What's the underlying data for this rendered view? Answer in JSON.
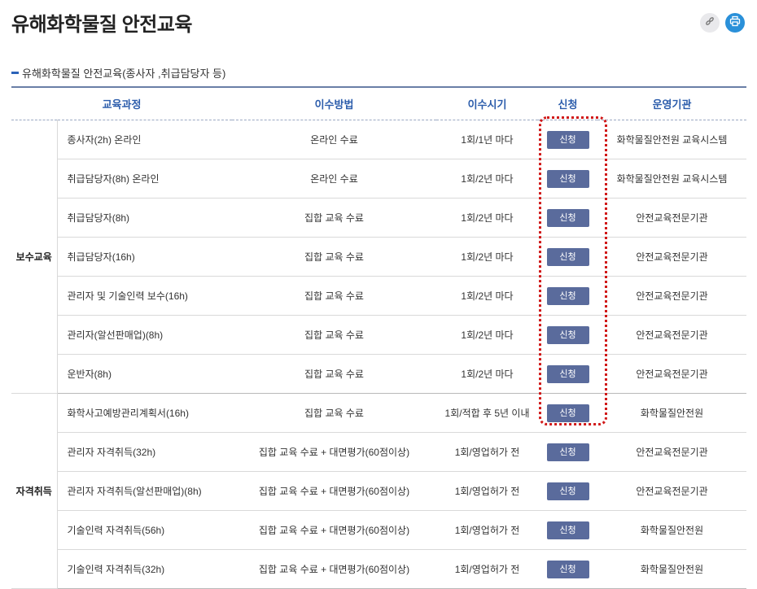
{
  "page": {
    "title": "유해화학물질 안전교육",
    "section_title": "유해화학물질 안전교육(종사자 ,취급담당자 등)"
  },
  "toolbar": {
    "link_icon": "link-icon",
    "print_icon": "print-icon",
    "print_color": "#2a90d9"
  },
  "table": {
    "headers": [
      "교육과정",
      "이수방법",
      "이수시기",
      "신청",
      "운영기관"
    ],
    "groups": [
      {
        "label": "보수교육",
        "rows": [
          {
            "course": "종사자(2h) 온라인",
            "method": "온라인 수료",
            "period": "1회/1년 마다",
            "apply": "신청",
            "org": "화학물질안전원 교육시스템"
          },
          {
            "course": "취급담당자(8h) 온라인",
            "method": "온라인 수료",
            "period": "1회/2년 마다",
            "apply": "신청",
            "org": "화학물질안전원 교육시스템"
          },
          {
            "course": "취급담당자(8h)",
            "method": "집합 교육 수료",
            "period": "1회/2년 마다",
            "apply": "신청",
            "org": "안전교육전문기관"
          },
          {
            "course": "취급담당자(16h)",
            "method": "집합 교육 수료",
            "period": "1회/2년 마다",
            "apply": "신청",
            "org": "안전교육전문기관"
          },
          {
            "course": "관리자 및 기술인력 보수(16h)",
            "method": "집합 교육 수료",
            "period": "1회/2년 마다",
            "apply": "신청",
            "org": "안전교육전문기관"
          },
          {
            "course": "관리자(알선판매업)(8h)",
            "method": "집합 교육 수료",
            "period": "1회/2년 마다",
            "apply": "신청",
            "org": "안전교육전문기관"
          },
          {
            "course": "운반자(8h)",
            "method": "집합 교육 수료",
            "period": "1회/2년 마다",
            "apply": "신청",
            "org": "안전교육전문기관"
          }
        ]
      },
      {
        "label": "자격취득",
        "rows": [
          {
            "course": "화학사고예방관리계획서(16h)",
            "method": "집합 교육 수료",
            "period": "1회/적합 후 5년 이내",
            "apply": "신청",
            "org": "화학물질안전원"
          },
          {
            "course": "관리자 자격취득(32h)",
            "method": "집합 교육 수료 + 대면평가(60점이상)",
            "period": "1회/영업허가 전",
            "apply": "신청",
            "org": "안전교육전문기관"
          },
          {
            "course": "관리자 자격취득(알선판매업)(8h)",
            "method": "집합 교육 수료 + 대면평가(60점이상)",
            "period": "1회/영업허가 전",
            "apply": "신청",
            "org": "안전교육전문기관"
          },
          {
            "course": "기술인력 자격취득(56h)",
            "method": "집합 교육 수료 + 대면평가(60점이상)",
            "period": "1회/영업허가 전",
            "apply": "신청",
            "org": "화학물질안전원"
          },
          {
            "course": "기술인력 자격취득(32h)",
            "method": "집합 교육 수료 + 대면평가(60점이상)",
            "period": "1회/영업허가 전",
            "apply": "신청",
            "org": "화학물질안전원"
          }
        ]
      }
    ]
  },
  "colors": {
    "accent": "#2b5cab",
    "button": "#5a6b9c",
    "highlight": "#d01818"
  }
}
